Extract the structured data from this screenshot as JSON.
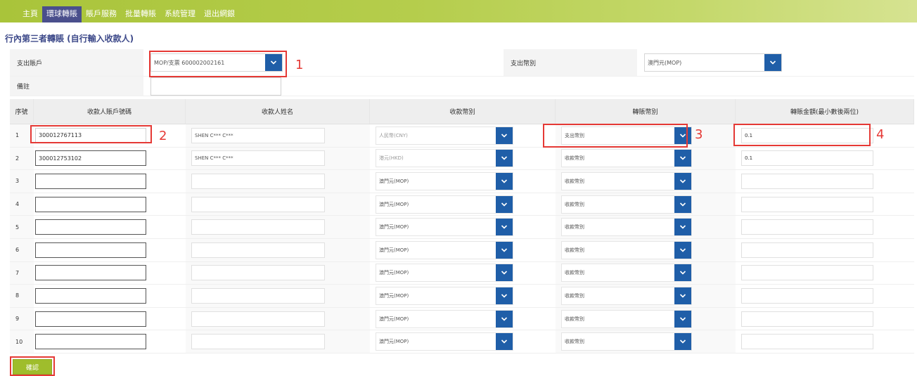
{
  "nav": {
    "items": [
      {
        "label": "主頁"
      },
      {
        "label": "環球轉賬"
      },
      {
        "label": "賬戶服務"
      },
      {
        "label": "批量轉賬"
      },
      {
        "label": "系統管理"
      },
      {
        "label": "退出網銀"
      }
    ]
  },
  "page": {
    "title": "行內第三者轉賬 (自行輸入收款人)"
  },
  "form": {
    "debit_account_label": "支出賬戶",
    "debit_account_value": "MOP/支票 600002002161",
    "debit_currency_label": "支出幣別",
    "debit_currency_value": "澳門元(MOP)",
    "remark_label": "備註",
    "remark_value": ""
  },
  "table": {
    "headers": [
      "序號",
      "收款人賬戶號碼",
      "收款人姓名",
      "收款幣別",
      "轉賬幣別",
      "轉賬金額(最小數後兩位)"
    ],
    "rows": [
      {
        "index": "1",
        "account": "300012767113",
        "name": "SHEN C*** C***",
        "currency": "人民幣(CNY)",
        "transfer_currency": "支出幣別",
        "amount": "0.1"
      },
      {
        "index": "2",
        "account": "300012753102",
        "name": "SHEN C*** C***",
        "currency": "港元(HKD)",
        "transfer_currency": "收款幣別",
        "amount": "0.1"
      },
      {
        "index": "3",
        "account": "",
        "name": "",
        "currency": "澳門元(MOP)",
        "transfer_currency": "收款幣別",
        "amount": ""
      },
      {
        "index": "4",
        "account": "",
        "name": "",
        "currency": "澳門元(MOP)",
        "transfer_currency": "收款幣別",
        "amount": ""
      },
      {
        "index": "5",
        "account": "",
        "name": "",
        "currency": "澳門元(MOP)",
        "transfer_currency": "收款幣別",
        "amount": ""
      },
      {
        "index": "6",
        "account": "",
        "name": "",
        "currency": "澳門元(MOP)",
        "transfer_currency": "收款幣別",
        "amount": ""
      },
      {
        "index": "7",
        "account": "",
        "name": "",
        "currency": "澳門元(MOP)",
        "transfer_currency": "收款幣別",
        "amount": ""
      },
      {
        "index": "8",
        "account": "",
        "name": "",
        "currency": "澳門元(MOP)",
        "transfer_currency": "收款幣別",
        "amount": ""
      },
      {
        "index": "9",
        "account": "",
        "name": "",
        "currency": "澳門元(MOP)",
        "transfer_currency": "收款幣別",
        "amount": ""
      },
      {
        "index": "10",
        "account": "",
        "name": "",
        "currency": "澳門元(MOP)",
        "transfer_currency": "收款幣別",
        "amount": ""
      }
    ]
  },
  "annotations": {
    "m1": "1",
    "m2": "2",
    "m3": "3",
    "m4": "4"
  },
  "buttons": {
    "confirm": "確認"
  },
  "colors": {
    "nav_bar": "#a9c43a",
    "nav_active": "#4a4f8c",
    "caret_button": "#1f5ea8",
    "highlight": "#e53935",
    "confirm_button": "#9fbd2c"
  },
  "icons": {
    "caret": "chevron-down-icon"
  }
}
